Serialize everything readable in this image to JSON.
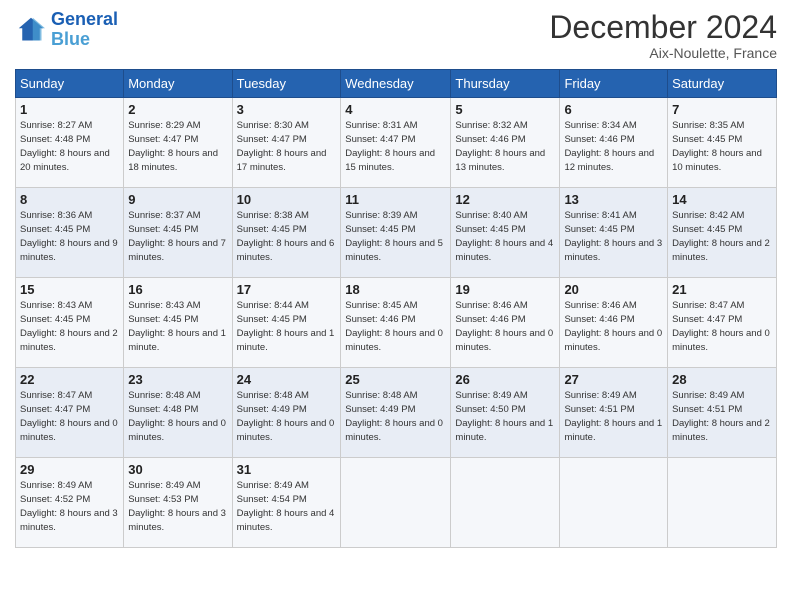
{
  "header": {
    "logo_line1": "General",
    "logo_line2": "Blue",
    "month_year": "December 2024",
    "location": "Aix-Noulette, France"
  },
  "weekdays": [
    "Sunday",
    "Monday",
    "Tuesday",
    "Wednesday",
    "Thursday",
    "Friday",
    "Saturday"
  ],
  "weeks": [
    [
      {
        "day": "1",
        "sunrise": "8:27 AM",
        "sunset": "4:48 PM",
        "daylight": "8 hours and 20 minutes."
      },
      {
        "day": "2",
        "sunrise": "8:29 AM",
        "sunset": "4:47 PM",
        "daylight": "8 hours and 18 minutes."
      },
      {
        "day": "3",
        "sunrise": "8:30 AM",
        "sunset": "4:47 PM",
        "daylight": "8 hours and 17 minutes."
      },
      {
        "day": "4",
        "sunrise": "8:31 AM",
        "sunset": "4:47 PM",
        "daylight": "8 hours and 15 minutes."
      },
      {
        "day": "5",
        "sunrise": "8:32 AM",
        "sunset": "4:46 PM",
        "daylight": "8 hours and 13 minutes."
      },
      {
        "day": "6",
        "sunrise": "8:34 AM",
        "sunset": "4:46 PM",
        "daylight": "8 hours and 12 minutes."
      },
      {
        "day": "7",
        "sunrise": "8:35 AM",
        "sunset": "4:45 PM",
        "daylight": "8 hours and 10 minutes."
      }
    ],
    [
      {
        "day": "8",
        "sunrise": "8:36 AM",
        "sunset": "4:45 PM",
        "daylight": "8 hours and 9 minutes."
      },
      {
        "day": "9",
        "sunrise": "8:37 AM",
        "sunset": "4:45 PM",
        "daylight": "8 hours and 7 minutes."
      },
      {
        "day": "10",
        "sunrise": "8:38 AM",
        "sunset": "4:45 PM",
        "daylight": "8 hours and 6 minutes."
      },
      {
        "day": "11",
        "sunrise": "8:39 AM",
        "sunset": "4:45 PM",
        "daylight": "8 hours and 5 minutes."
      },
      {
        "day": "12",
        "sunrise": "8:40 AM",
        "sunset": "4:45 PM",
        "daylight": "8 hours and 4 minutes."
      },
      {
        "day": "13",
        "sunrise": "8:41 AM",
        "sunset": "4:45 PM",
        "daylight": "8 hours and 3 minutes."
      },
      {
        "day": "14",
        "sunrise": "8:42 AM",
        "sunset": "4:45 PM",
        "daylight": "8 hours and 2 minutes."
      }
    ],
    [
      {
        "day": "15",
        "sunrise": "8:43 AM",
        "sunset": "4:45 PM",
        "daylight": "8 hours and 2 minutes."
      },
      {
        "day": "16",
        "sunrise": "8:43 AM",
        "sunset": "4:45 PM",
        "daylight": "8 hours and 1 minute."
      },
      {
        "day": "17",
        "sunrise": "8:44 AM",
        "sunset": "4:45 PM",
        "daylight": "8 hours and 1 minute."
      },
      {
        "day": "18",
        "sunrise": "8:45 AM",
        "sunset": "4:46 PM",
        "daylight": "8 hours and 0 minutes."
      },
      {
        "day": "19",
        "sunrise": "8:46 AM",
        "sunset": "4:46 PM",
        "daylight": "8 hours and 0 minutes."
      },
      {
        "day": "20",
        "sunrise": "8:46 AM",
        "sunset": "4:46 PM",
        "daylight": "8 hours and 0 minutes."
      },
      {
        "day": "21",
        "sunrise": "8:47 AM",
        "sunset": "4:47 PM",
        "daylight": "8 hours and 0 minutes."
      }
    ],
    [
      {
        "day": "22",
        "sunrise": "8:47 AM",
        "sunset": "4:47 PM",
        "daylight": "8 hours and 0 minutes."
      },
      {
        "day": "23",
        "sunrise": "8:48 AM",
        "sunset": "4:48 PM",
        "daylight": "8 hours and 0 minutes."
      },
      {
        "day": "24",
        "sunrise": "8:48 AM",
        "sunset": "4:49 PM",
        "daylight": "8 hours and 0 minutes."
      },
      {
        "day": "25",
        "sunrise": "8:48 AM",
        "sunset": "4:49 PM",
        "daylight": "8 hours and 0 minutes."
      },
      {
        "day": "26",
        "sunrise": "8:49 AM",
        "sunset": "4:50 PM",
        "daylight": "8 hours and 1 minute."
      },
      {
        "day": "27",
        "sunrise": "8:49 AM",
        "sunset": "4:51 PM",
        "daylight": "8 hours and 1 minute."
      },
      {
        "day": "28",
        "sunrise": "8:49 AM",
        "sunset": "4:51 PM",
        "daylight": "8 hours and 2 minutes."
      }
    ],
    [
      {
        "day": "29",
        "sunrise": "8:49 AM",
        "sunset": "4:52 PM",
        "daylight": "8 hours and 3 minutes."
      },
      {
        "day": "30",
        "sunrise": "8:49 AM",
        "sunset": "4:53 PM",
        "daylight": "8 hours and 3 minutes."
      },
      {
        "day": "31",
        "sunrise": "8:49 AM",
        "sunset": "4:54 PM",
        "daylight": "8 hours and 4 minutes."
      },
      null,
      null,
      null,
      null
    ]
  ]
}
